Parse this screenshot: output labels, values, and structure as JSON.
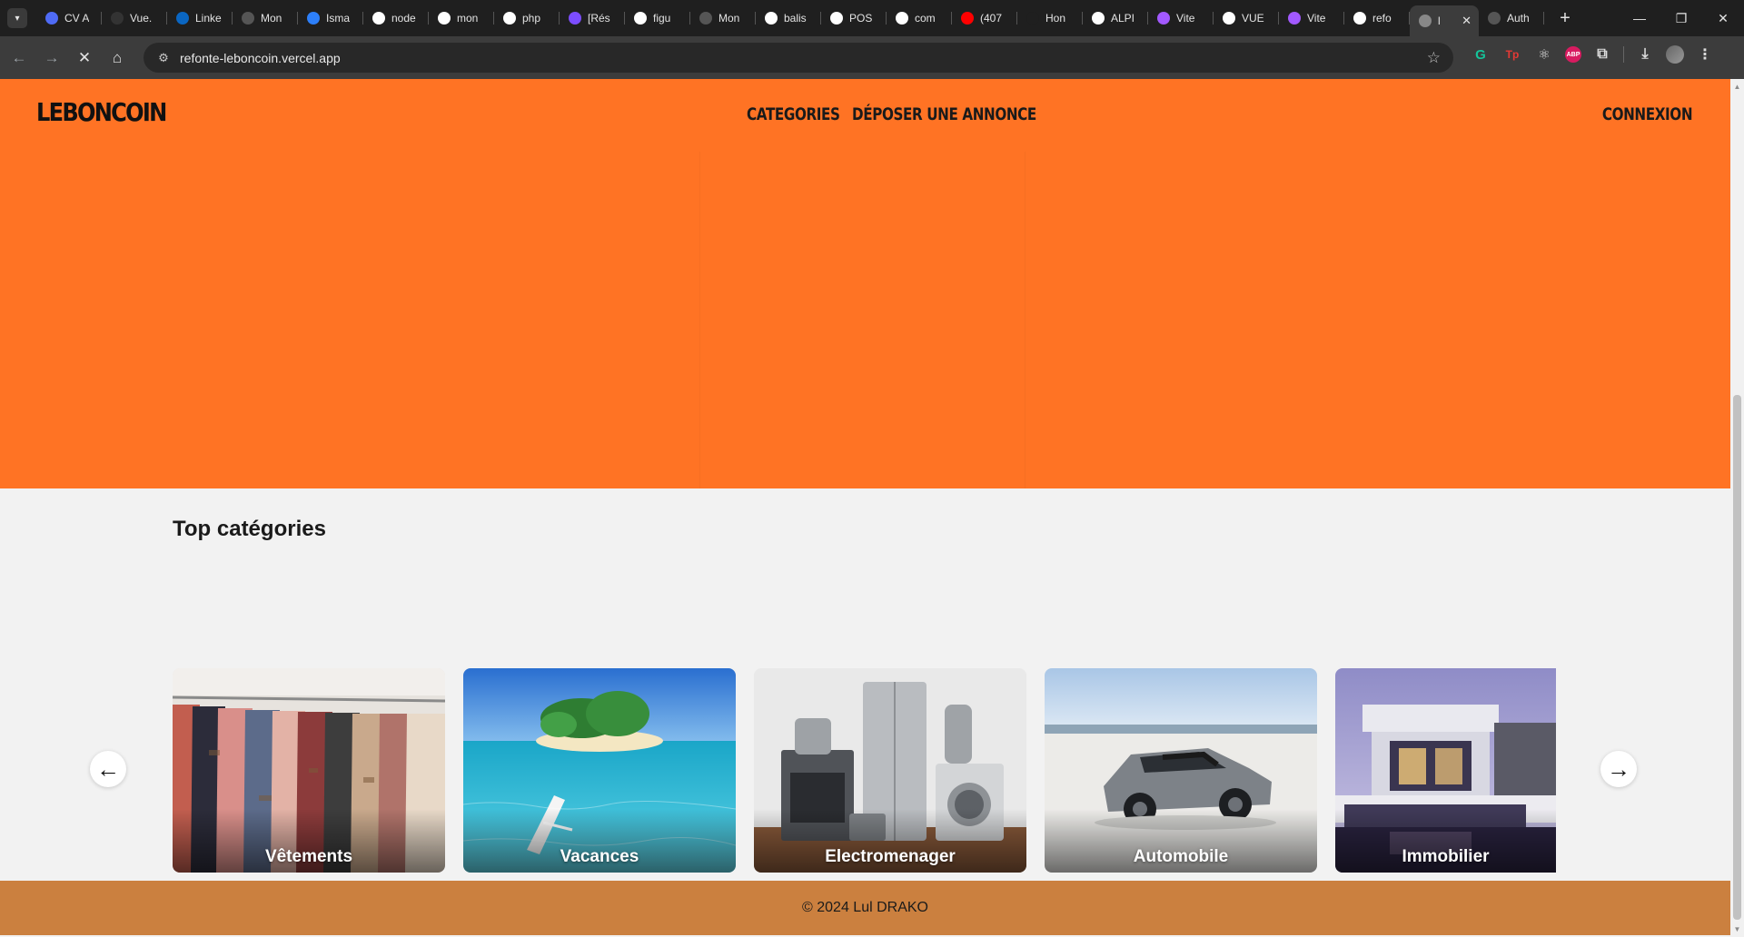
{
  "browser": {
    "tabs": [
      {
        "label": "CV A",
        "icon": "doc-icon",
        "color": "#4f6bf5"
      },
      {
        "label": "Vue.",
        "icon": "github-icon",
        "color": "#333333"
      },
      {
        "label": "Linke",
        "icon": "linkedin-icon",
        "color": "#0a66c2"
      },
      {
        "label": "Mon",
        "icon": "globe-icon",
        "color": "#555555"
      },
      {
        "label": "Isma",
        "icon": "ig-icon",
        "color": "#2d7ff9"
      },
      {
        "label": "node",
        "icon": "google-icon",
        "color": "#ffffff"
      },
      {
        "label": "mon",
        "icon": "google-icon",
        "color": "#ffffff"
      },
      {
        "label": "php",
        "icon": "google-icon",
        "color": "#ffffff"
      },
      {
        "label": "[Rés",
        "icon": "d-icon",
        "color": "#7c4dff"
      },
      {
        "label": "figu",
        "icon": "google-icon",
        "color": "#ffffff"
      },
      {
        "label": "Mon",
        "icon": "globe-icon",
        "color": "#555555"
      },
      {
        "label": "balis",
        "icon": "google-icon",
        "color": "#ffffff"
      },
      {
        "label": "POS",
        "icon": "google-icon",
        "color": "#ffffff"
      },
      {
        "label": "com",
        "icon": "google-icon",
        "color": "#ffffff"
      },
      {
        "label": "(407",
        "icon": "youtube-icon",
        "color": "#ff0000"
      },
      {
        "label": "Hon",
        "icon": "fi-icon",
        "color": "#1f1f1f"
      },
      {
        "label": "ALPI",
        "icon": "google-icon",
        "color": "#ffffff"
      },
      {
        "label": "Vite",
        "icon": "vite-icon",
        "color": "#a259ff"
      },
      {
        "label": "VUE",
        "icon": "notion-icon",
        "color": "#ffffff"
      },
      {
        "label": "Vite",
        "icon": "vite-icon",
        "color": "#a259ff"
      },
      {
        "label": "refo",
        "icon": "vercel-icon",
        "color": "#ffffff"
      },
      {
        "label": "l",
        "icon": "loading-icon",
        "color": "#888888",
        "active": true
      },
      {
        "label": "Auth",
        "icon": "globe-icon",
        "color": "#555555"
      }
    ],
    "url": "refonte-leboncoin.vercel.app"
  },
  "header": {
    "logo": "LEBONCOIN",
    "nav": {
      "categories": "CATEGORIES",
      "post_ad": "DÉPOSER UNE ANNONCE"
    },
    "login": "CONNEXION"
  },
  "colors": {
    "hero": "#ff7324",
    "footer": "#cb803f",
    "page": "#f2f2f2"
  },
  "top_categories": {
    "title": "Top catégories",
    "items": [
      {
        "label": "Vêtements",
        "image": "clothing-rack-photo"
      },
      {
        "label": "Vacances",
        "image": "tropical-island-photo"
      },
      {
        "label": "Electromenager",
        "image": "home-appliances-photo"
      },
      {
        "label": "Automobile",
        "image": "grey-car-photo"
      },
      {
        "label": "Immobilier",
        "image": "modern-house-photo"
      }
    ]
  },
  "footer": {
    "text": "© 2024 Lul DRAKO"
  }
}
